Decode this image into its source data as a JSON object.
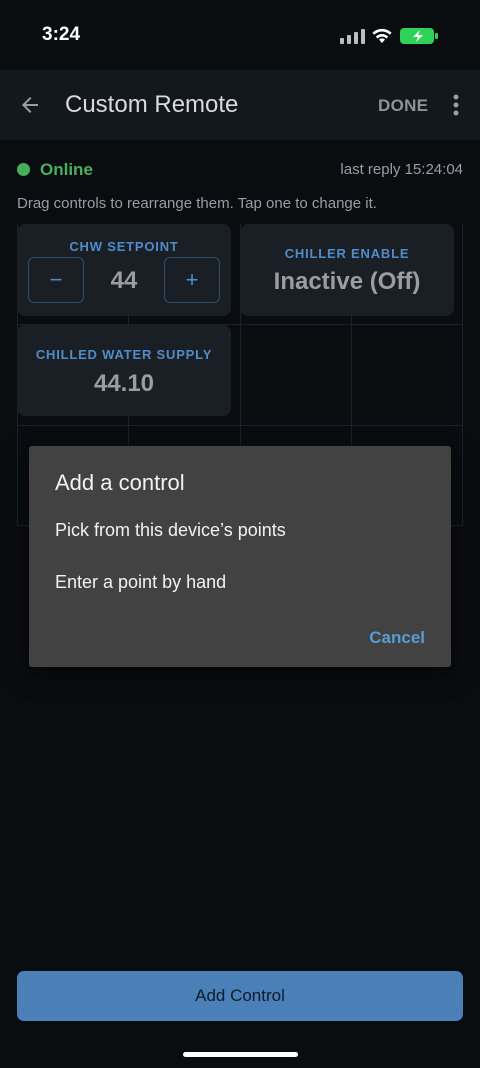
{
  "status_bar": {
    "time": "3:24",
    "battery_color": "#30d158"
  },
  "app_bar": {
    "title": "Custom Remote",
    "done_label": "DONE",
    "back_icon": "arrow-left-icon",
    "more_icon": "more-vert-icon"
  },
  "connection": {
    "status": "Online",
    "status_color": "#4caf5e",
    "last_reply": "last reply 15:24:04"
  },
  "hint": "Drag controls to rearrange them. Tap one to change it.",
  "controls": {
    "setpoint": {
      "label": "CHW SETPOINT",
      "value": "44",
      "minus": "−",
      "plus": "+"
    },
    "chiller_enable": {
      "label": "CHILLER ENABLE",
      "value": "Inactive (Off)"
    },
    "chilled_water_supply": {
      "label": "CHILLED WATER SUPPLY",
      "value": "44.10"
    }
  },
  "dialog": {
    "title": "Add a control",
    "options": [
      "Pick from this device’s points",
      "Enter a point by hand"
    ],
    "cancel_label": "Cancel"
  },
  "bottom": {
    "add_control_label": "Add Control"
  },
  "colors": {
    "accent": "#4f8cc9",
    "button": "#4a7fb8",
    "dialog_bg": "#424242"
  }
}
